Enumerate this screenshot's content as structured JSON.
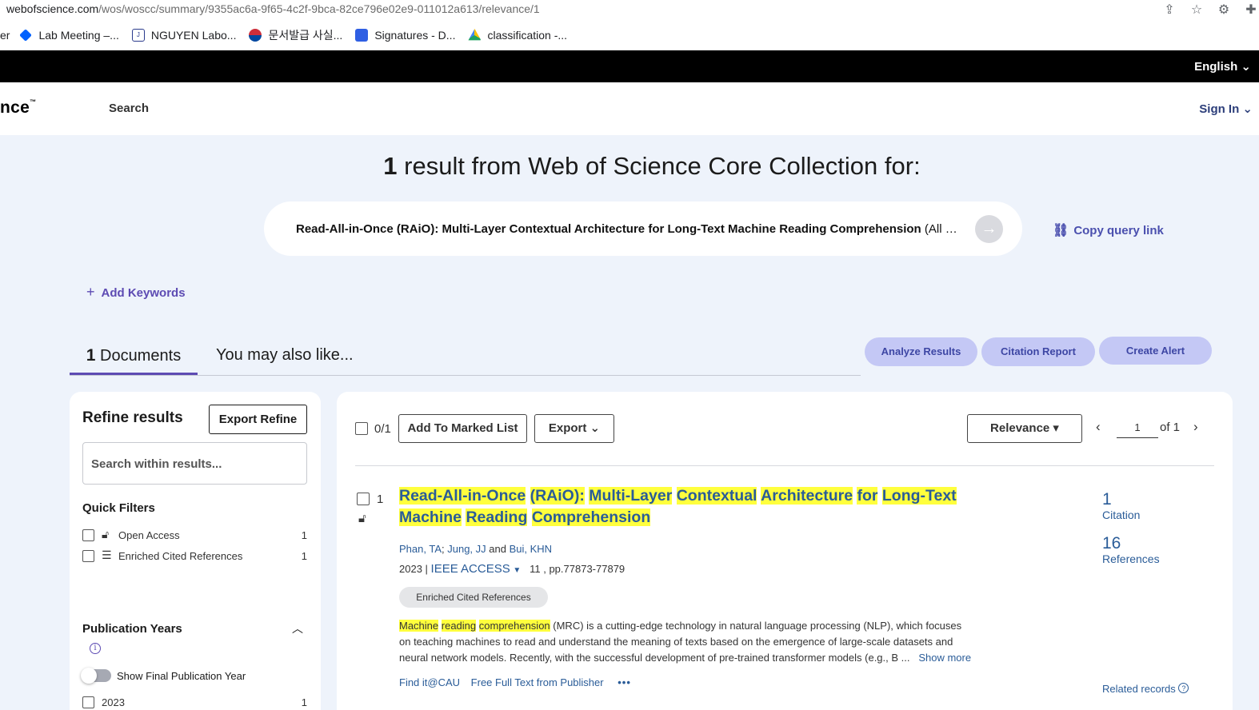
{
  "browser": {
    "url_host": "webofscience.com",
    "url_path": "/wos/woscc/summary/9355ac6a-9f65-4c2f-9bca-82ce796e02e9-011012a613/relevance/1",
    "bookmarks": [
      {
        "label": "er",
        "icon": "partial"
      },
      {
        "label": "Lab Meeting –...",
        "icon": "dropbox-icon",
        "color": "#0061fe"
      },
      {
        "label": "NGUYEN Labo...",
        "icon": "jaist-icon",
        "color": "#2a3a8c"
      },
      {
        "label": "문서발급 사실...",
        "icon": "korea-flag-icon",
        "color": "#cd2e3a"
      },
      {
        "label": "Signatures - D...",
        "icon": "dropbox-sign-icon",
        "color": "#2f5fe3"
      },
      {
        "label": "classification -...",
        "icon": "drive-icon",
        "color": "#1fa463"
      }
    ]
  },
  "topbar": {
    "language": "English ⌄"
  },
  "header": {
    "logo": "nce",
    "logo_tm": "™",
    "nav_search": "Search",
    "sign_in": "Sign In ⌄"
  },
  "summary": {
    "count": "1",
    "title_rest": " result from Web of Science Core Collection for:",
    "query_bold": "Read-All-in-Once (RAiO): Multi-Layer Contextual Architecture for Long-Text Machine Reading Comprehension",
    "query_rest": " (All Fie...",
    "copy_query_link": "Copy query link",
    "add_keywords": "Add Keywords"
  },
  "tabs": {
    "docs_count": "1",
    "docs_label": " Documents",
    "also_like": "You may also like..."
  },
  "actions": {
    "analyze": "Analyze Results",
    "citation_report": "Citation Report",
    "create_alert": "Create Alert"
  },
  "refine": {
    "title": "Refine results",
    "export_refine": "Export Refine",
    "search_placeholder": "Search within results...",
    "quick_filters_title": "Quick Filters",
    "quick_filters": [
      {
        "label": "Open Access",
        "count": "1",
        "icon": "lock-open-icon"
      },
      {
        "label": "Enriched Cited References",
        "count": "1",
        "icon": "enriched-list-icon"
      }
    ],
    "pub_years_title": "Publication Years",
    "show_final_year": "Show Final Publication Year",
    "years": [
      {
        "label": "2023",
        "count": "1"
      }
    ]
  },
  "results_toolbar": {
    "selected": "0/1",
    "add_marked": "Add To Marked List",
    "export": "Export ⌄",
    "sort": "Relevance ▾",
    "page": "1",
    "of_pages": "of 1"
  },
  "record": {
    "index": "1",
    "title_words": [
      "Read-All-in-Once",
      " ",
      "(RAiO):",
      " ",
      "Multi-Layer",
      " ",
      "Contextual",
      " ",
      "Architecture",
      " ",
      "for",
      " ",
      "Long-Text",
      " ",
      "Machine",
      " ",
      "Reading",
      " ",
      "Comprehension"
    ],
    "authors": [
      "Phan, TA",
      "Jung, JJ",
      "Bui, KHN"
    ],
    "author_sep1": "; ",
    "author_sep2": " and ",
    "year": "2023",
    "journal": "IEEE ACCESS",
    "volume_pages": "11 , pp.77873-77879",
    "enriched_badge": "Enriched Cited References",
    "abstract_h1": "Machine",
    "abstract_h2": "reading",
    "abstract_h3": "comprehension",
    "abstract_rest": " (MRC) is a cutting-edge technology in natural language processing (NLP), which focuses on teaching machines to read and understand the meaning of texts based on the emergence of large-scale datasets and neural network models. Recently, with the successful development of pre-trained transformer models (e.g., B ...",
    "show_more": "Show more",
    "find_it": "Find it@CAU",
    "free_full_text": "Free Full Text from Publisher",
    "more_dots": "•••",
    "citations_count": "1",
    "citations_label": "Citation",
    "references_count": "16",
    "references_label": "References",
    "related_records": "Related records"
  }
}
